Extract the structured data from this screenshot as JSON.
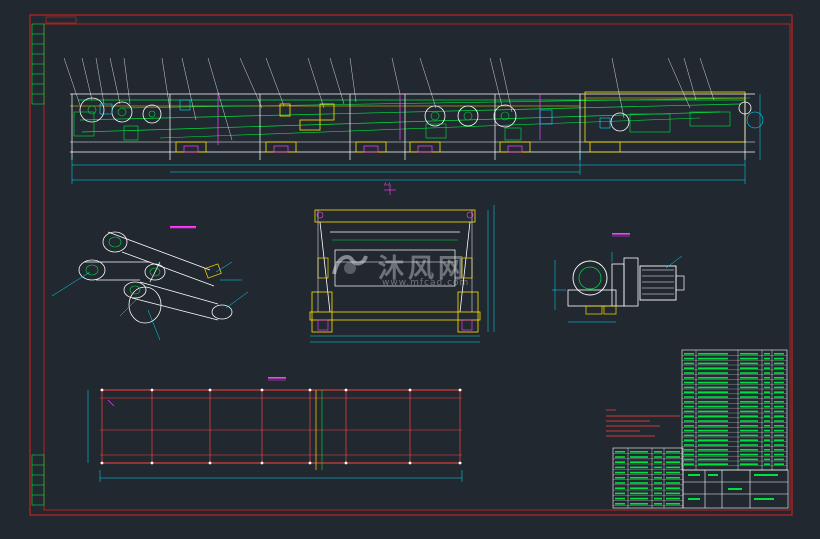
{
  "drawing": {
    "watermark_cn": "沐风网",
    "watermark_url": "www.mfcad.com",
    "section_label": "A-A",
    "colors": {
      "background": "#212830",
      "frame": "#e02020",
      "belt": "#00e040",
      "structure": "#ffffff",
      "rollers": "#ffe000",
      "dimension": "#00e0ff",
      "leader": "#ff40ff"
    },
    "icons": [
      "mfcad-logo-icon"
    ]
  }
}
